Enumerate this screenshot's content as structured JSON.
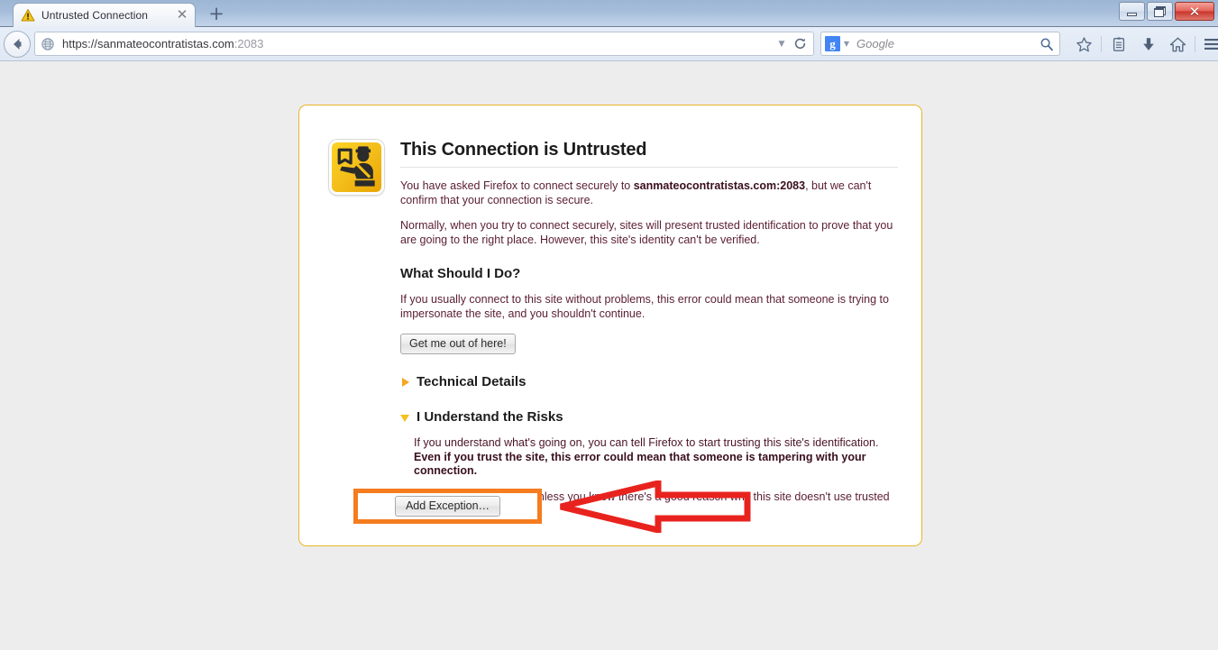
{
  "window": {
    "controls": [
      {
        "name": "minimize",
        "label": "Minimize"
      },
      {
        "name": "restore",
        "label": "Restore"
      },
      {
        "name": "close",
        "label": "Close",
        "glyph": "✕",
        "color": "#c8352b"
      }
    ]
  },
  "tabbar": {
    "tabs": [
      {
        "title": "Untrusted Connection",
        "favicon": "warning-triangle-icon",
        "close_glyph": "✕"
      }
    ],
    "new_tab_glyph": "+"
  },
  "toolbar": {
    "back_label": "Back",
    "url": {
      "scheme": "https://",
      "host": "sanmateocontratistas.com",
      "port": ":2083",
      "full": "https://sanmateocontratistas.com:2083",
      "favicon": "globe-icon",
      "dropdown_glyph": "▼",
      "reload_glyph": "↻"
    },
    "search": {
      "engine": "Google",
      "engine_initial": "g",
      "placeholder": "Google",
      "dropdown_glyph": "▼",
      "engine_color": "#4285f4"
    },
    "icons": [
      {
        "name": "bookmark-star-icon",
        "label": "Bookmark this page"
      },
      {
        "name": "reading-list-icon",
        "label": "Show your bookmarks"
      },
      {
        "name": "downloads-icon",
        "label": "Downloads"
      },
      {
        "name": "home-icon",
        "label": "Home"
      },
      {
        "name": "menu-icon",
        "label": "Open menu"
      }
    ]
  },
  "page": {
    "warning_icon": "customs-officer-icon",
    "title": "This Connection is Untrusted",
    "intro": {
      "pre": "You have asked Firefox to connect securely to ",
      "strong": "sanmateocontratistas.com:2083",
      "post": ", but we can't confirm that your connection is secure."
    },
    "normally": "Normally, when you try to connect securely, sites will present trusted identification to prove that you are going to the right place. However, this site's identity can't be verified.",
    "what_should_i_do": {
      "heading": "What Should I Do?",
      "text": "If you usually connect to this site without problems, this error could mean that someone is trying to impersonate the site, and you shouldn't continue.",
      "button": "Get me out of here!"
    },
    "technical_details": {
      "label": "Technical Details",
      "expanded": false,
      "marker": "collapsed-triangle-right"
    },
    "risks": {
      "label": "I Understand the Risks",
      "expanded": true,
      "marker": "expanded-triangle-down",
      "paragraph1": {
        "normal": "If you understand what's going on, you can tell Firefox to start trusting this site's identification. ",
        "strong": "Even if you trust the site, this error could mean that someone is tampering with your connection."
      },
      "paragraph2": "Don't add an exception unless you know there's a good reason why this site doesn't use trusted identification.",
      "button": "Add Exception…"
    }
  },
  "annotations": {
    "highlight_box": {
      "name": "orange-highlight-box",
      "color": "#f57c1f"
    },
    "arrow": {
      "name": "red-arrow-annotation",
      "color": "#e8231e",
      "direction": "left"
    }
  },
  "colors": {
    "card_border": "#e9b529",
    "page_background": "#ededed",
    "titlebar": "#a6bedb",
    "text": "#5a1d33"
  }
}
